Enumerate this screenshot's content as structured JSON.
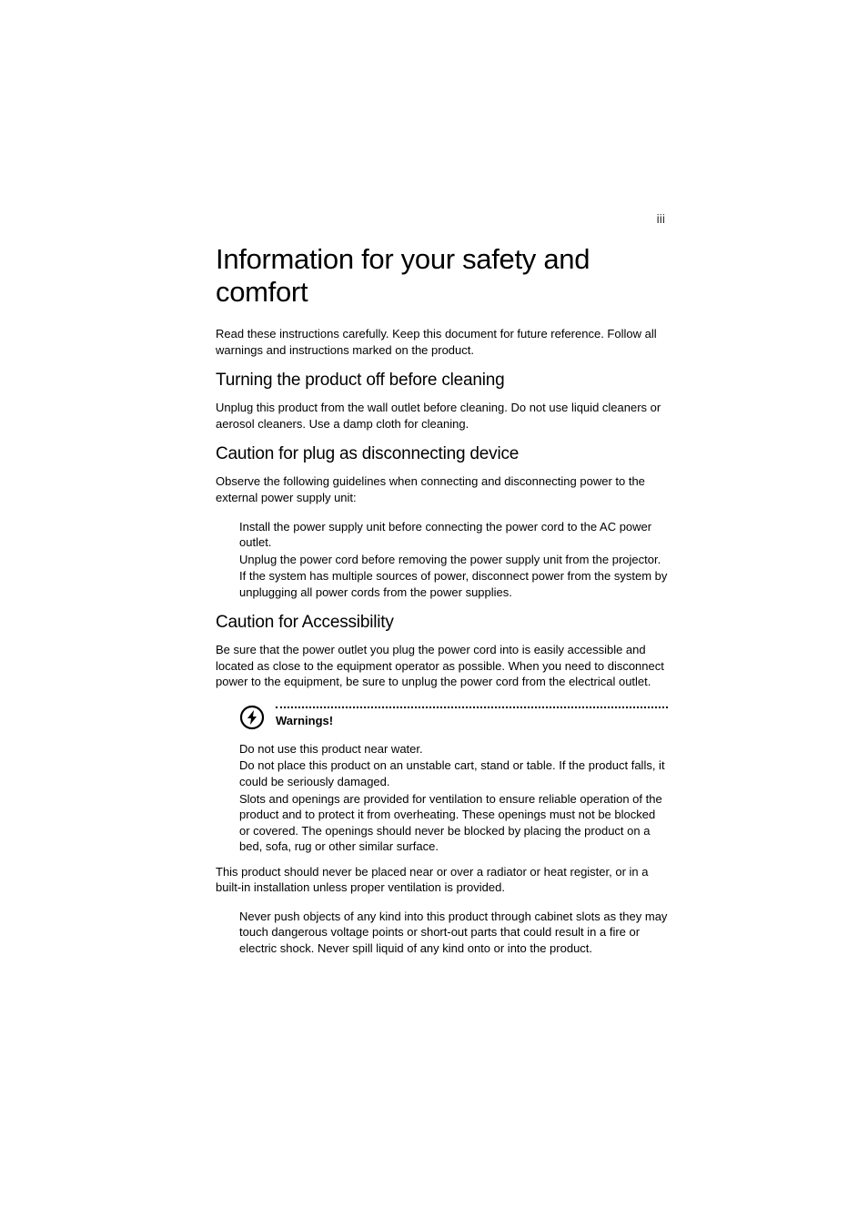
{
  "page_number": "iii",
  "title": "Information for your safety and comfort",
  "intro": "Read these instructions carefully. Keep this document for future reference. Follow all warnings and instructions marked on the product.",
  "sections": {
    "cleaning": {
      "heading": "Turning the product off before cleaning",
      "body": "Unplug this product from the wall outlet before cleaning. Do not use liquid cleaners or aerosol cleaners. Use a damp cloth for cleaning."
    },
    "plug": {
      "heading": "Caution for plug as disconnecting device",
      "intro": "Observe the following guidelines when connecting and disconnecting power to the external power supply unit:",
      "items": [
        "Install the power supply unit before connecting the power cord to the AC power outlet.",
        "Unplug the power cord before removing the power supply unit from the projector.",
        "If the system has multiple sources of power, disconnect power from the system by unplugging all power cords from the power supplies."
      ]
    },
    "accessibility": {
      "heading": "Caution for Accessibility",
      "body": "Be sure that the power outlet you plug the power cord into is easily accessible and located as close to the equipment operator as possible. When you need to disconnect power to the equipment, be sure to unplug the power cord from the electrical outlet."
    }
  },
  "warnings": {
    "label": "Warnings!",
    "items_a": [
      "Do not use this product near water.",
      "Do not place this product on an unstable cart, stand or table. If the product falls, it could be seriously damaged.",
      "Slots and openings are provided for ventilation to ensure reliable operation of the product and to protect it from overheating. These openings must not be blocked or covered. The openings should never be blocked by placing the product on a bed, sofa, rug or other similar surface."
    ],
    "mid_para": "This product should never be placed near or over a radiator or heat register, or in a built-in installation unless proper ventilation is provided.",
    "items_b": [
      "Never push objects of any kind into this product through cabinet slots as they may touch dangerous voltage points or short-out parts that could result in a fire or electric shock. Never spill liquid of any kind onto or into the product."
    ]
  }
}
